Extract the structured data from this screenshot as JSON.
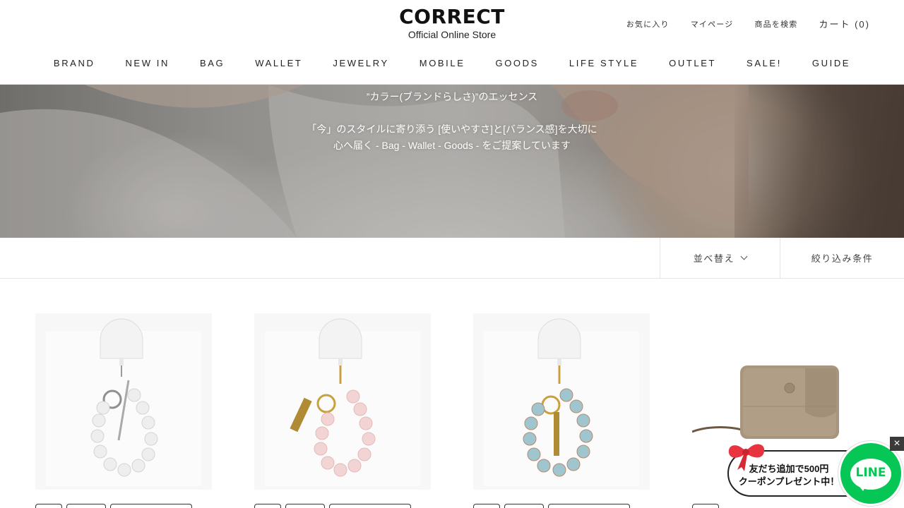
{
  "header": {
    "logo_title": "CORRECT",
    "logo_subtitle": "Official Online Store",
    "util_links": [
      "お気に入り",
      "マイページ",
      "商品を検索"
    ],
    "cart_label": "カート (0)"
  },
  "main_nav": [
    "BRAND",
    "NEW IN",
    "BAG",
    "WALLET",
    "JEWELRY",
    "MOBILE",
    "GOODS",
    "LIFE STYLE",
    "OUTLET",
    "SALE!",
    "GUIDE"
  ],
  "hero": {
    "line1": "”カラー(ブランドらしさ)”のエッセンス",
    "line2": "「今」のスタイルに寄り添う [使いやすさ]と[バランス感]を大切に",
    "line3": "心へ届く - Bag - Wallet - Goods - をご提案しています"
  },
  "toolbar": {
    "sort_label": "並べ替え",
    "filter_label": "絞り込み条件"
  },
  "products": [
    {
      "type": "heart-beads-strap",
      "color": "white"
    },
    {
      "type": "heart-beads-strap",
      "color": "pink"
    },
    {
      "type": "heart-beads-strap",
      "color": "turquoise"
    },
    {
      "type": "mini-wallet",
      "color": "taupe"
    }
  ],
  "line_banner": {
    "text_line1": "友だち追加で500円",
    "text_line2": "クーポンプレゼント中！",
    "logo_text": "LINE",
    "close_label": "×",
    "brand_color": "#06c755"
  }
}
